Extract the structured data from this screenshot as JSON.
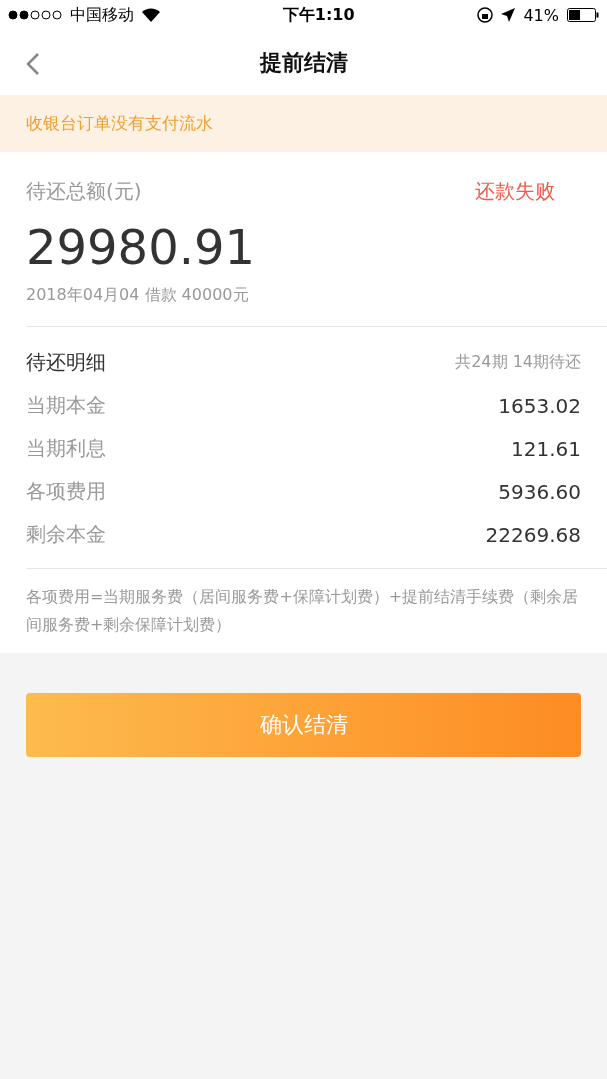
{
  "status_bar": {
    "carrier": "中国移动",
    "time": "下午1:10",
    "battery": "41%"
  },
  "nav": {
    "title": "提前结清"
  },
  "alert": "收银台订单没有支付流水",
  "summary": {
    "label": "待还总额(元)",
    "status": "还款失败",
    "amount": "29980.91",
    "info": "2018年04月04 借款 40000元"
  },
  "details": {
    "title": "待还明细",
    "periods": "共24期 14期待还",
    "rows": [
      {
        "label": "当期本金",
        "value": "1653.02"
      },
      {
        "label": "当期利息",
        "value": "121.61"
      },
      {
        "label": "各项费用",
        "value": "5936.60"
      },
      {
        "label": "剩余本金",
        "value": "22269.68"
      }
    ]
  },
  "note": "各项费用=当期服务费（居间服务费+保障计划费）+提前结清手续费（剩余居间服务费+剩余保障计划费）",
  "confirm_button": "确认结清"
}
